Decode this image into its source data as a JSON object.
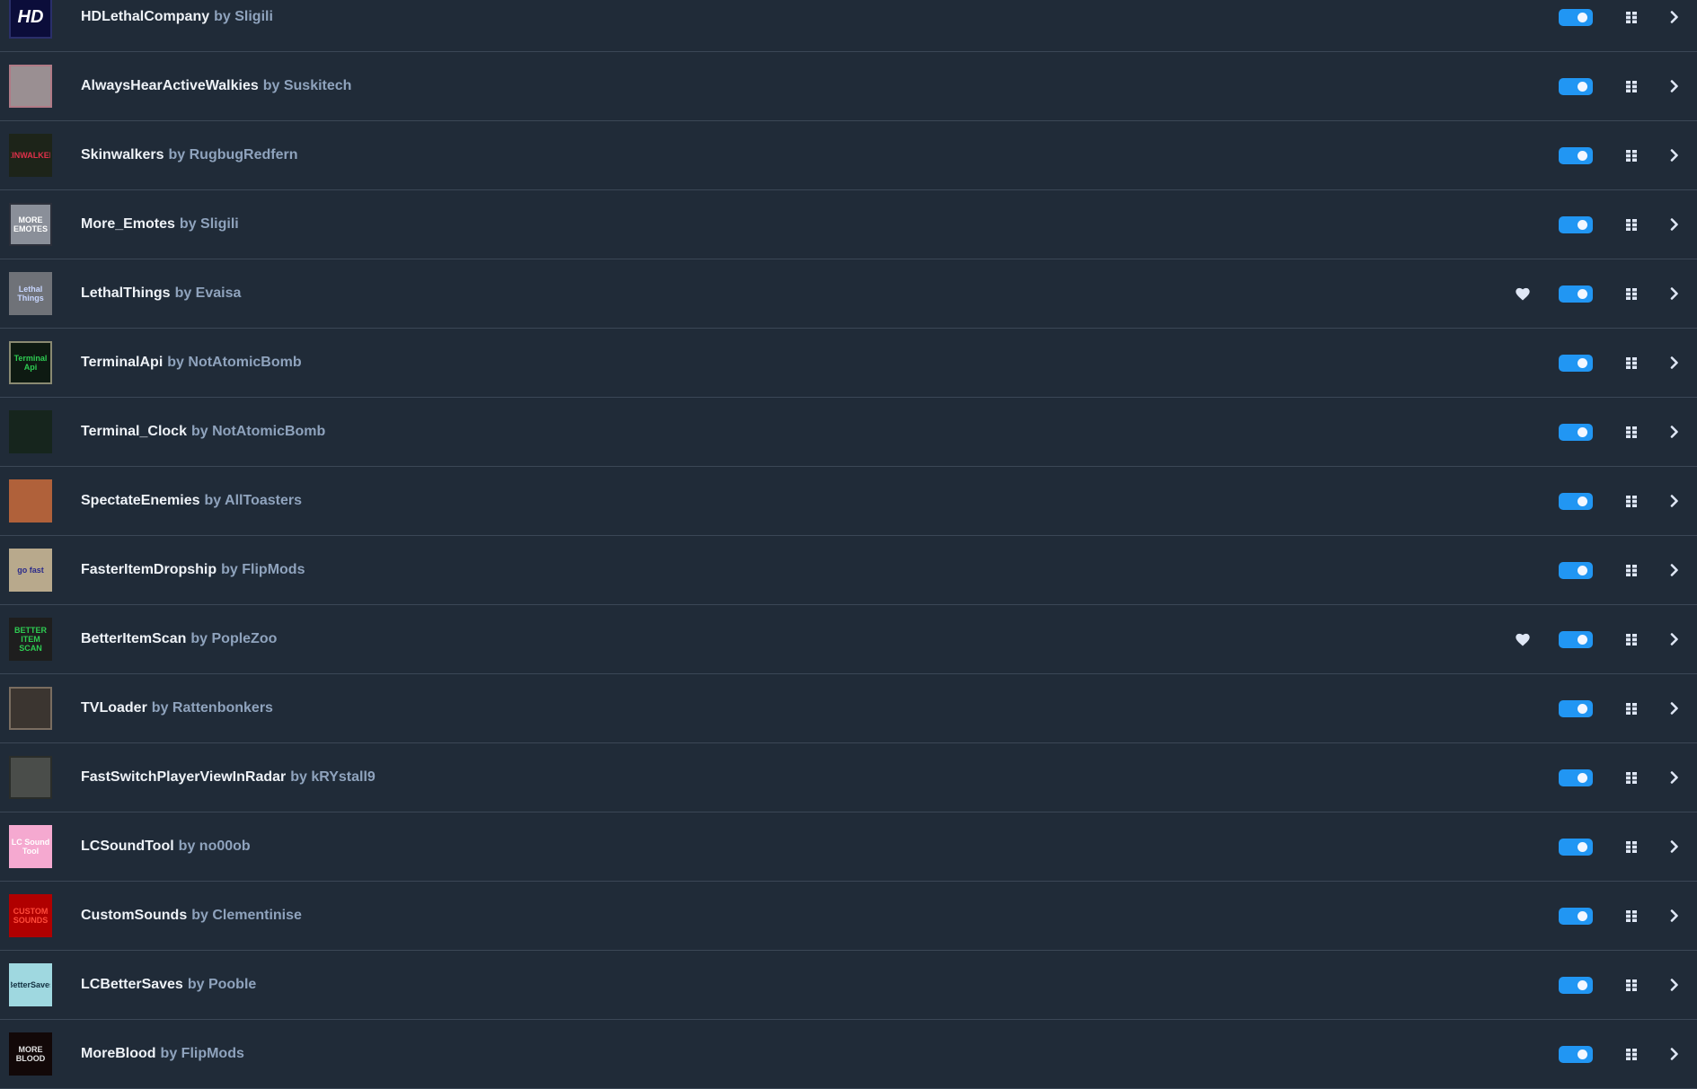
{
  "colors": {
    "background": "#202b38",
    "divider": "#3b4756",
    "toggle_on": "#2196f3",
    "mod_name": "#eef2f7",
    "author": "#8fa3bd",
    "icon": "#dfe7f5"
  },
  "by_prefix": "by",
  "mods": [
    {
      "name": "HDLethalCompany",
      "author": "Sligili",
      "enabled": true,
      "favorite": false,
      "thumb": {
        "label": "HD",
        "bg": "#0b0d3a",
        "fg": "#ffffff",
        "border": "#2a2f6a"
      }
    },
    {
      "name": "AlwaysHearActiveWalkies",
      "author": "Suskitech",
      "enabled": true,
      "favorite": false,
      "thumb": {
        "label": "",
        "bg": "#9a8f92",
        "fg": "#ffffff",
        "border": "#b07a86"
      }
    },
    {
      "name": "Skinwalkers",
      "author": "RugbugRedfern",
      "enabled": true,
      "favorite": false,
      "thumb": {
        "label": "SKINWALKERS",
        "bg": "#1d2419",
        "fg": "#e0304a",
        "border": "#1d2419"
      }
    },
    {
      "name": "More_Emotes",
      "author": "Sligili",
      "enabled": true,
      "favorite": false,
      "thumb": {
        "label": "MORE EMOTES",
        "bg": "#8a8f99",
        "fg": "#ffffff",
        "border": "#2b2f3a"
      }
    },
    {
      "name": "LethalThings",
      "author": "Evaisa",
      "enabled": true,
      "favorite": true,
      "thumb": {
        "label": "Lethal Things",
        "bg": "#6f7278",
        "fg": "#c7d6ff",
        "border": "#6f7278"
      }
    },
    {
      "name": "TerminalApi",
      "author": "NotAtomicBomb",
      "enabled": true,
      "favorite": false,
      "thumb": {
        "label": "Terminal Api",
        "bg": "#0e1a12",
        "fg": "#2ecc52",
        "border": "#8a8a72"
      }
    },
    {
      "name": "Terminal_Clock",
      "author": "NotAtomicBomb",
      "enabled": true,
      "favorite": false,
      "thumb": {
        "label": "",
        "bg": "#16251d",
        "fg": "#2ecc52",
        "border": "#16251d"
      }
    },
    {
      "name": "SpectateEnemies",
      "author": "AllToasters",
      "enabled": true,
      "favorite": false,
      "thumb": {
        "label": "",
        "bg": "#b0613a",
        "fg": "#f0c040",
        "border": "#b0613a"
      }
    },
    {
      "name": "FasterItemDropship",
      "author": "FlipMods",
      "enabled": true,
      "favorite": false,
      "thumb": {
        "label": "go fast",
        "bg": "#b8a98c",
        "fg": "#2a2a8a",
        "border": "#b8a98c"
      }
    },
    {
      "name": "BetterItemScan",
      "author": "PopleZoo",
      "enabled": true,
      "favorite": true,
      "thumb": {
        "label": "BETTER ITEM SCAN",
        "bg": "#1e1e1e",
        "fg": "#2ecc52",
        "border": "#1e1e1e"
      }
    },
    {
      "name": "TVLoader",
      "author": "Rattenbonkers",
      "enabled": true,
      "favorite": false,
      "thumb": {
        "label": "",
        "bg": "#3b3530",
        "fg": "#ffffff",
        "border": "#7a6d60"
      }
    },
    {
      "name": "FastSwitchPlayerViewInRadar",
      "author": "kRYstall9",
      "enabled": true,
      "favorite": false,
      "thumb": {
        "label": "",
        "bg": "#4a4d4a",
        "fg": "#ffffff",
        "border": "#2a2d2a"
      }
    },
    {
      "name": "LCSoundTool",
      "author": "no00ob",
      "enabled": true,
      "favorite": false,
      "thumb": {
        "label": "LC Sound Tool",
        "bg": "#f5a9d0",
        "fg": "#ffffff",
        "border": "#f5a9d0"
      }
    },
    {
      "name": "CustomSounds",
      "author": "Clementinise",
      "enabled": true,
      "favorite": false,
      "thumb": {
        "label": "CUSTOM SOUNDS",
        "bg": "#b00000",
        "fg": "#ff4a3a",
        "border": "#b00000"
      }
    },
    {
      "name": "LCBetterSaves",
      "author": "Pooble",
      "enabled": true,
      "favorite": false,
      "thumb": {
        "label": "BetterSaves",
        "bg": "#9fd8e0",
        "fg": "#123040",
        "border": "#9fd8e0"
      }
    },
    {
      "name": "MoreBlood",
      "author": "FlipMods",
      "enabled": true,
      "favorite": false,
      "thumb": {
        "label": "MORE BLOOD",
        "bg": "#120808",
        "fg": "#e0e0e0",
        "border": "#120808"
      }
    }
  ]
}
